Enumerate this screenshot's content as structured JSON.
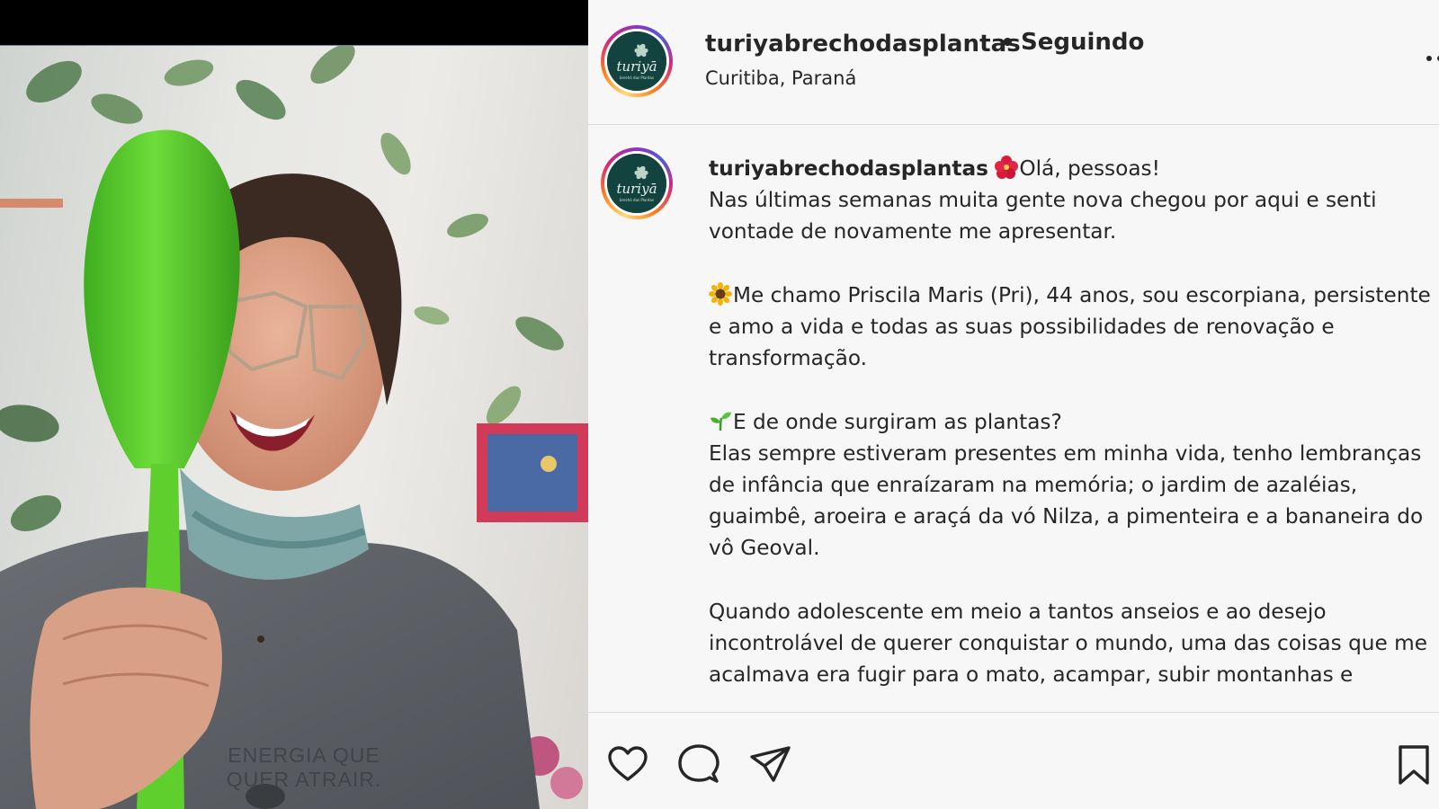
{
  "post": {
    "username": "turiyabrechodasplantas",
    "separator": "•",
    "follow_status": "Seguindo",
    "location": "Curitiba, Paraná",
    "avatar_logo_text": "turiyā",
    "avatar_logo_subtext": "brechó das Plantas",
    "photo_shirt_text_line1": "ENERGIA QUE",
    "photo_shirt_text_line2": "QUER ATRAIR."
  },
  "caption": {
    "username": "turiyabrechodasplantas",
    "paragraphs": [
      {
        "emoji": "hibiscus-emoji",
        "text": "Olá, pessoas!"
      },
      {
        "text": "Nas últimas semanas muita gente nova chegou por aqui e senti vontade de novamente me apresentar."
      },
      {
        "emoji": "sunflower-emoji",
        "text": "Me chamo Priscila Maris (Pri), 44 anos, sou escorpiana, persistente e amo a vida e todas as suas possibilidades de renovação e transformação."
      },
      {
        "emoji": "seedling-emoji",
        "text": "E de onde surgiram as plantas?"
      },
      {
        "text": "Elas sempre estiveram presentes em minha vida, tenho lembranças de infância que enraízaram na memória; o jardim de azaléias, guaimbê, aroeira e araçá da vó Nilza, a pimenteira e a bananeira do vô Geoval."
      },
      {
        "text": "Quando adolescente em meio a tantos anseios e ao desejo incontrolável de querer conquistar o mundo, uma das coisas que me acalmava era fugir para o mato, acampar, subir montanhas e"
      }
    ]
  },
  "actions": {
    "icons": [
      "heart-icon",
      "comment-icon",
      "share-icon",
      "bookmark-icon"
    ]
  },
  "colors": {
    "panel_bg": "#f7f7f7",
    "text": "#262626",
    "divider": "#dbdbdb",
    "avatar_logo_bg": "#12433f",
    "trowel_green": "#52c52a"
  }
}
